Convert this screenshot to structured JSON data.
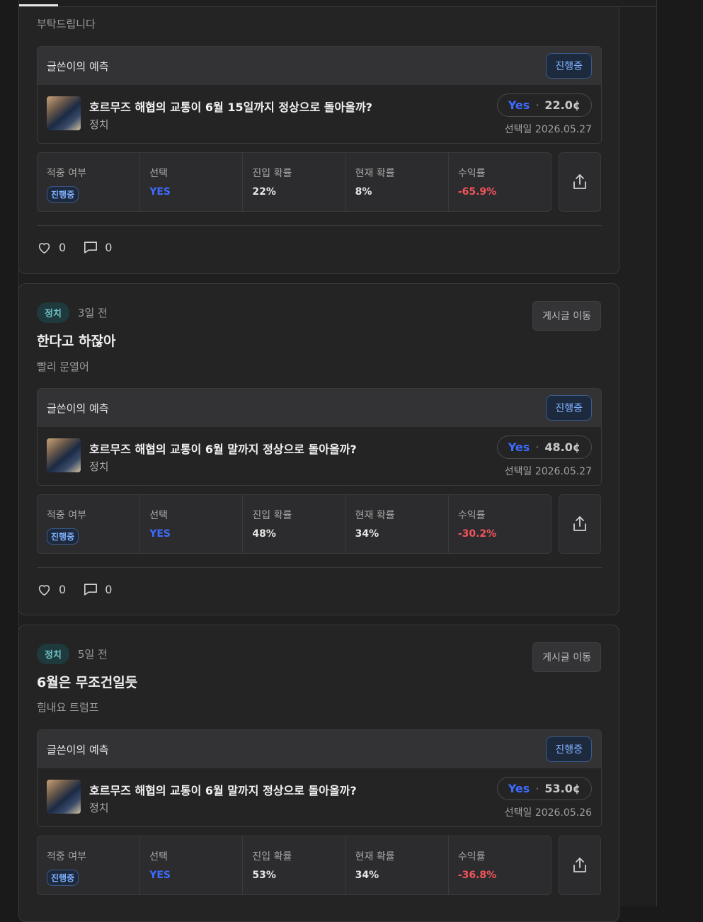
{
  "posts": [
    {
      "body": "부탁드립니다",
      "prediction": {
        "header": "글쓴이의 예측",
        "status": "진행중",
        "question": "호르무즈 해협의 교통이 6월 15일까지 정상으로 돌아올까?",
        "category": "정치",
        "choice": "Yes",
        "separator": "·",
        "price": "22.0¢",
        "selected_date": "선택일 2026.05.27"
      },
      "stats": {
        "hit_label": "적중 여부",
        "hit_value": "진행중",
        "choice_label": "선택",
        "choice_value": "YES",
        "entry_label": "진입 확률",
        "entry_value": "22%",
        "current_label": "현재 확률",
        "current_value": "8%",
        "return_label": "수익률",
        "return_value": "-65.9%"
      },
      "likes": "0",
      "comments": "0"
    },
    {
      "tag": "정치",
      "time": "3일 전",
      "goto": "게시글 이동",
      "title": "한다고 하잖아",
      "body": "빨리 문열어",
      "prediction": {
        "header": "글쓴이의 예측",
        "status": "진행중",
        "question": "호르무즈 해협의 교통이 6월 말까지 정상으로 돌아올까?",
        "category": "정치",
        "choice": "Yes",
        "separator": "·",
        "price": "48.0¢",
        "selected_date": "선택일 2026.05.27"
      },
      "stats": {
        "hit_label": "적중 여부",
        "hit_value": "진행중",
        "choice_label": "선택",
        "choice_value": "YES",
        "entry_label": "진입 확률",
        "entry_value": "48%",
        "current_label": "현재 확률",
        "current_value": "34%",
        "return_label": "수익률",
        "return_value": "-30.2%"
      },
      "likes": "0",
      "comments": "0"
    },
    {
      "tag": "정치",
      "time": "5일 전",
      "goto": "게시글 이동",
      "title": "6월은 무조건일듯",
      "body": "힘내요 트럼프",
      "prediction": {
        "header": "글쓴이의 예측",
        "status": "진행중",
        "question": "호르무즈 해협의 교통이 6월 말까지 정상으로 돌아올까?",
        "category": "정치",
        "choice": "Yes",
        "separator": "·",
        "price": "53.0¢",
        "selected_date": "선택일 2026.05.26"
      },
      "stats": {
        "hit_label": "적중 여부",
        "hit_value": "진행중",
        "choice_label": "선택",
        "choice_value": "YES",
        "entry_label": "진입 확률",
        "entry_value": "53%",
        "current_label": "현재 확률",
        "current_value": "34%",
        "return_label": "수익률",
        "return_value": "-36.8%"
      }
    }
  ],
  "colors": {
    "accent_blue": "#3d6cff",
    "negative_red": "#f2545b",
    "tag_teal": "#6fc3c9",
    "status_blue": "#7fb0ff"
  },
  "icons": [
    "heart-icon",
    "comment-icon",
    "share-icon"
  ]
}
